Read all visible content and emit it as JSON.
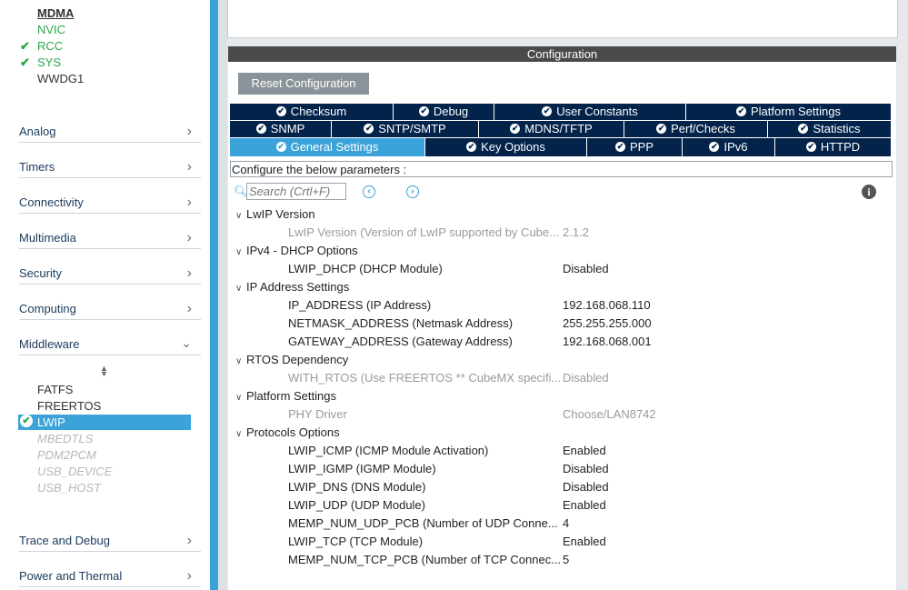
{
  "left": {
    "system_items": [
      {
        "label": "MDMA",
        "checked": false,
        "style": "bold"
      },
      {
        "label": "NVIC",
        "checked": false,
        "style": "green"
      },
      {
        "label": "RCC",
        "checked": true,
        "style": "green"
      },
      {
        "label": "SYS",
        "checked": true,
        "style": "green"
      },
      {
        "label": "WWDG1",
        "checked": false,
        "style": "normal"
      }
    ],
    "categories": [
      {
        "label": "Analog"
      },
      {
        "label": "Timers"
      },
      {
        "label": "Connectivity"
      },
      {
        "label": "Multimedia"
      },
      {
        "label": "Security"
      },
      {
        "label": "Computing"
      },
      {
        "label": "Middleware"
      },
      {
        "label": "Trace and Debug"
      },
      {
        "label": "Power and Thermal"
      }
    ],
    "middleware_items": [
      {
        "label": "FATFS"
      },
      {
        "label": "FREERTOS"
      },
      {
        "label": "LWIP"
      },
      {
        "label": "MBEDTLS"
      },
      {
        "label": "PDM2PCM"
      },
      {
        "label": "USB_DEVICE"
      },
      {
        "label": "USB_HOST"
      }
    ]
  },
  "config": {
    "header": "Configuration",
    "reset_label": "Reset Configuration",
    "tabs_row1": [
      "Checksum",
      "Debug",
      "User Constants",
      "Platform Settings"
    ],
    "tabs_row2": [
      "SNMP",
      "SNTP/SMTP",
      "MDNS/TFTP",
      "Perf/Checks",
      "Statistics"
    ],
    "tabs_row3": [
      "General Settings",
      "Key Options",
      "PPP",
      "IPv6",
      "HTTPD"
    ],
    "configure_text": "Configure the below parameters :",
    "search_placeholder": "Search (Crtl+F)",
    "groups": [
      {
        "title": "LwIP Version",
        "rows": [
          {
            "name": "LwIP Version (Version of LwIP supported by Cube...",
            "value": "2.1.2",
            "disabled": true
          }
        ]
      },
      {
        "title": "IPv4 - DHCP Options",
        "rows": [
          {
            "name": "LWIP_DHCP (DHCP Module)",
            "value": "Disabled",
            "disabled": false
          }
        ]
      },
      {
        "title": "IP Address Settings",
        "rows": [
          {
            "name": "IP_ADDRESS (IP Address)",
            "value": "192.168.068.110",
            "disabled": false
          },
          {
            "name": "NETMASK_ADDRESS (Netmask Address)",
            "value": "255.255.255.000",
            "disabled": false
          },
          {
            "name": "GATEWAY_ADDRESS (Gateway Address)",
            "value": "192.168.068.001",
            "disabled": false
          }
        ]
      },
      {
        "title": "RTOS Dependency",
        "rows": [
          {
            "name": "WITH_RTOS (Use FREERTOS ** CubeMX specifi...",
            "value": "Disabled",
            "disabled": true
          }
        ]
      },
      {
        "title": "Platform Settings",
        "rows": [
          {
            "name": "PHY Driver",
            "value": "Choose/LAN8742",
            "disabled": true
          }
        ]
      },
      {
        "title": "Protocols Options",
        "rows": [
          {
            "name": "LWIP_ICMP (ICMP Module Activation)",
            "value": "Enabled",
            "disabled": false
          },
          {
            "name": "LWIP_IGMP (IGMP Module)",
            "value": "Disabled",
            "disabled": false
          },
          {
            "name": "LWIP_DNS (DNS Module)",
            "value": "Disabled",
            "disabled": false
          },
          {
            "name": "LWIP_UDP (UDP Module)",
            "value": "Enabled",
            "disabled": false
          },
          {
            "name": "MEMP_NUM_UDP_PCB (Number of UDP Conne...",
            "value": "4",
            "disabled": false
          },
          {
            "name": "LWIP_TCP (TCP Module)",
            "value": "Enabled",
            "disabled": false
          },
          {
            "name": "MEMP_NUM_TCP_PCB (Number of TCP Connec...",
            "value": "5",
            "disabled": false
          }
        ]
      }
    ]
  },
  "colors": {
    "accent": "#3ba3d9",
    "tab_dark": "#03234b",
    "enabled_green": "#2aa84a"
  }
}
